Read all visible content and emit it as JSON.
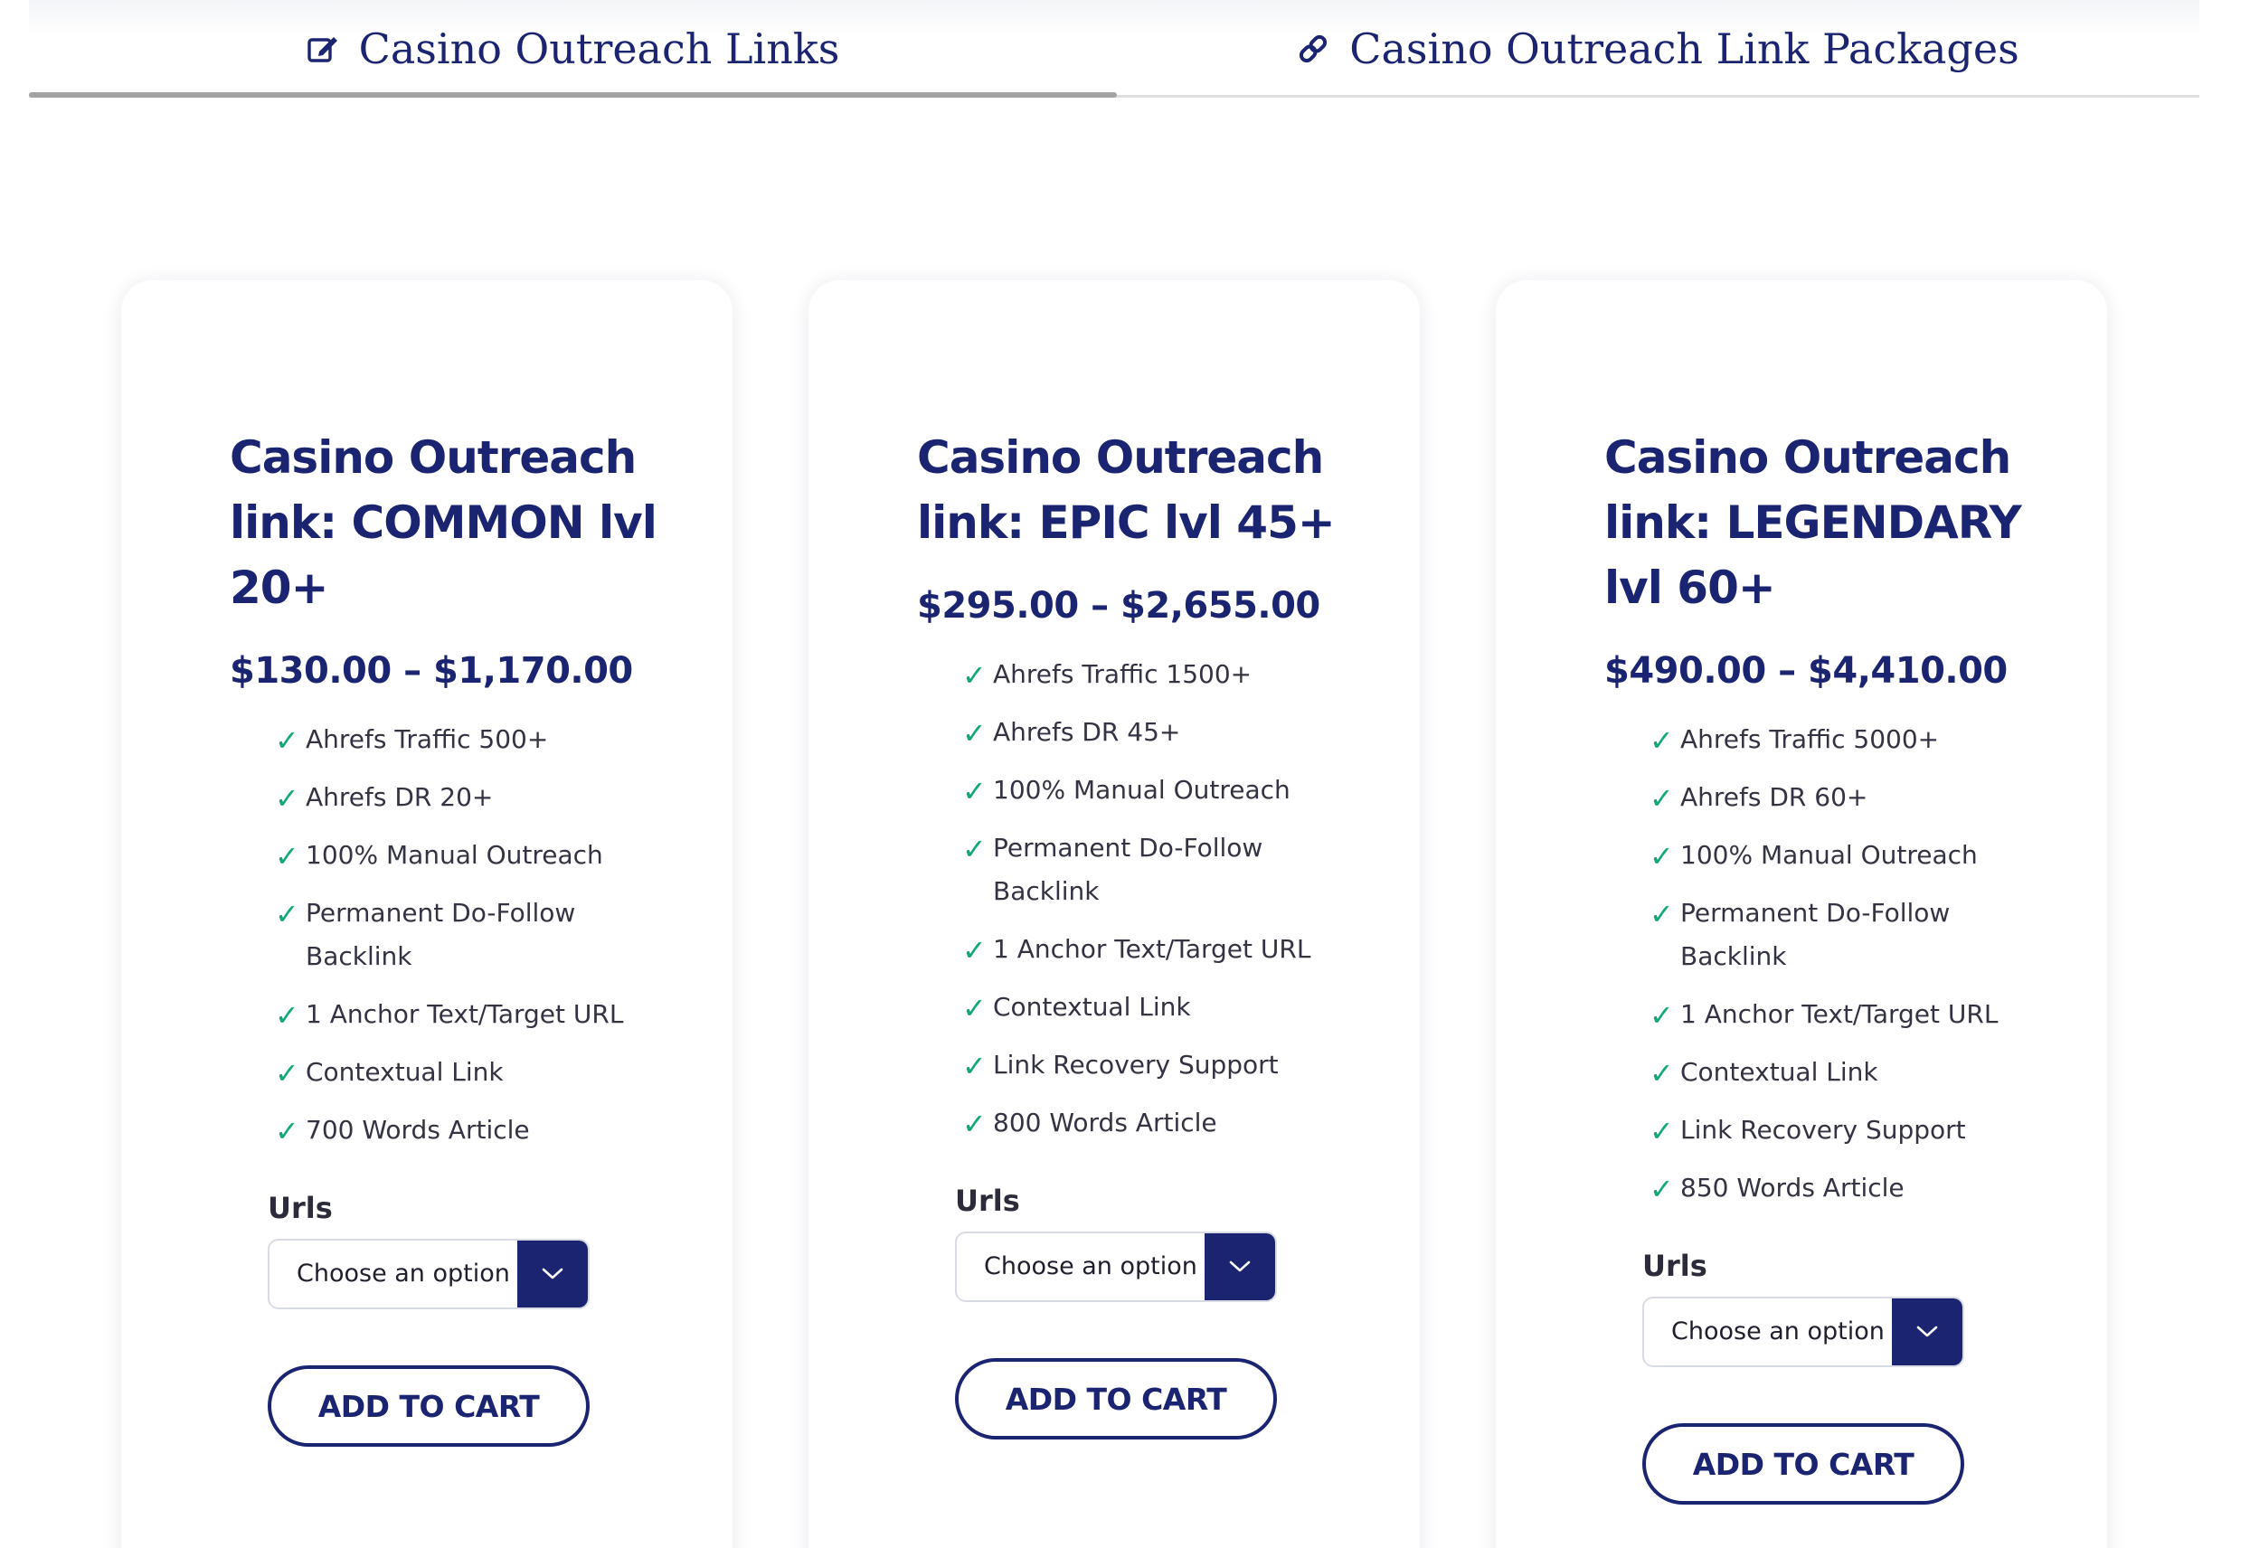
{
  "tabs": [
    {
      "label": "Casino Outreach Links",
      "icon": "edit-icon",
      "active": true
    },
    {
      "label": "Casino Outreach Link Packages",
      "icon": "link-icon",
      "active": false
    }
  ],
  "colors": {
    "brand_navy": "#1a2470",
    "check_green": "#13a67a",
    "tab_indicator": "#a3a3a3",
    "text_body": "#333344"
  },
  "products": [
    {
      "title": "Casino Outreach link: COMMON lvl 20+",
      "price": "$130.00 – $1,170.00",
      "features": [
        "Ahrefs Traffic 500+",
        "Ahrefs DR 20+",
        "100% Manual Outreach",
        "Permanent Do-Follow Backlink",
        "1 Anchor Text/Target URL",
        "Contextual Link",
        "700 Words Article"
      ],
      "urls_label": "Urls",
      "select_value": "Choose an option",
      "button_label": "ADD TO CART"
    },
    {
      "title": "Casino Outreach link: EPIC lvl 45+",
      "price": "$295.00 – $2,655.00",
      "features": [
        "Ahrefs Traffic 1500+",
        "Ahrefs DR 45+",
        "100% Manual Outreach",
        "Permanent Do-Follow Backlink",
        "1 Anchor Text/Target URL",
        "Contextual Link",
        "Link Recovery Support",
        "800 Words Article"
      ],
      "urls_label": "Urls",
      "select_value": "Choose an option",
      "button_label": "ADD TO CART"
    },
    {
      "title": "Casino Outreach link: LEGENDARY lvl 60+",
      "price": "$490.00 – $4,410.00",
      "features": [
        "Ahrefs Traffic 5000+",
        "Ahrefs DR 60+",
        "100% Manual Outreach",
        "Permanent Do-Follow Backlink",
        "1 Anchor Text/Target URL",
        "Contextual Link",
        "Link Recovery Support",
        "850 Words Article"
      ],
      "urls_label": "Urls",
      "select_value": "Choose an option",
      "button_label": "ADD TO CART"
    }
  ]
}
